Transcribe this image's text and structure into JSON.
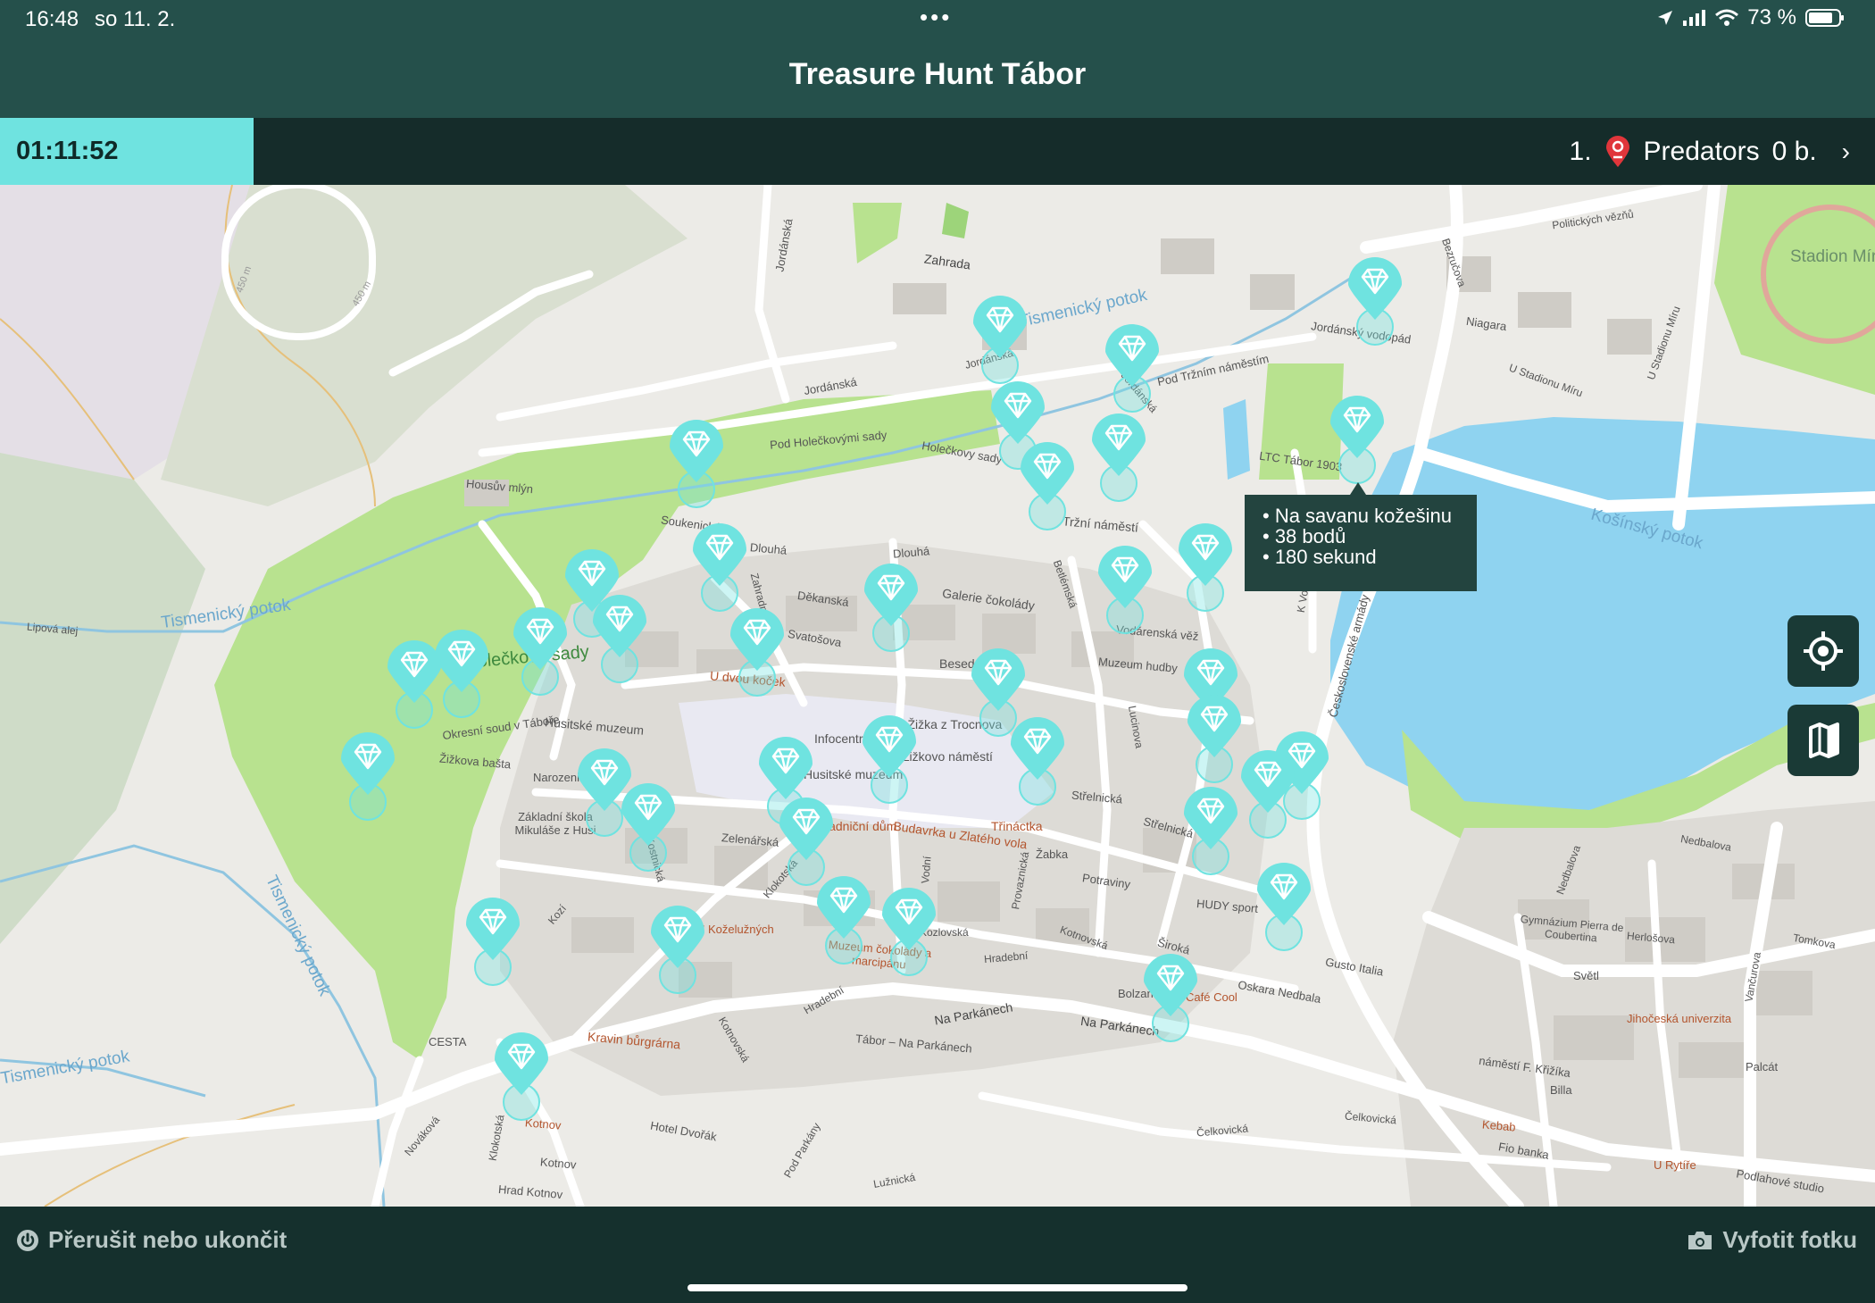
{
  "status_bar": {
    "time": "16:48",
    "date": "so 11. 2.",
    "battery": "73 %"
  },
  "app": {
    "title": "Treasure Hunt Tábor"
  },
  "scoreboard": {
    "timer": "01:11:52",
    "rank": "1.",
    "team": "Predators",
    "points": "0 b."
  },
  "tooltip": {
    "lines": [
      "• Na savanu kožešinu",
      "• 38 bodů",
      "• 180 sekund"
    ]
  },
  "map": {
    "labels": [
      {
        "text": "Jordánská",
        "rot": -80
      },
      {
        "text": "Zahrada",
        "rot": 8
      },
      {
        "text": "Tismenický potok",
        "rot": -12
      },
      {
        "text": "Jordánská",
        "rot": -10
      },
      {
        "text": "Pod Tržním náměstím",
        "rot": -12
      },
      {
        "text": "Jordánský vodopád",
        "rot": 8
      },
      {
        "text": "Politických vězňů",
        "rot": -8
      },
      {
        "text": "Stadion Míru",
        "rot": 0
      },
      {
        "text": "Bezručova",
        "rot": 70
      },
      {
        "text": "Niagara",
        "rot": 8
      },
      {
        "text": "U Stadionu Míru",
        "rot": 20
      },
      {
        "text": "U Stadionu Míru",
        "rot": -70
      },
      {
        "text": "Jordánská",
        "rot": -15
      },
      {
        "text": "Jordánská",
        "rot": 50
      },
      {
        "text": "Pod Holečkovými sady",
        "rot": -5
      },
      {
        "text": "Holečkovy sady",
        "rot": 10
      },
      {
        "text": "LTC Tábor 1903",
        "rot": 8
      },
      {
        "text": "Košínský potok",
        "rot": 15
      },
      {
        "text": "Housův mlýn",
        "rot": 5
      },
      {
        "text": "Soukenická",
        "rot": 8
      },
      {
        "text": "Dlouhá",
        "rot": 5
      },
      {
        "text": "Dlouhá",
        "rot": -5
      },
      {
        "text": "Tržní náměstí",
        "rot": 5
      },
      {
        "text": "Děkanská",
        "rot": 8
      },
      {
        "text": "Galerie čokolády",
        "rot": 8
      },
      {
        "text": "Betlémská",
        "rot": 70
      },
      {
        "text": "Zahradnická",
        "rot": 75
      },
      {
        "text": "Tismenický potok",
        "rot": -8
      },
      {
        "text": "Lipová alej",
        "rot": 5
      },
      {
        "text": "Holečkovy sady",
        "rot": -5
      },
      {
        "text": "Svatošova",
        "rot": 10
      },
      {
        "text": "U dvou koček",
        "rot": 5
      },
      {
        "text": "Beseda",
        "rot": 0
      },
      {
        "text": "Vodárenská věž",
        "rot": 5
      },
      {
        "text": "Muzeum hudby",
        "rot": 5
      },
      {
        "text": "K Vodojemu",
        "rot": -80
      },
      {
        "text": "Československé armády",
        "rot": -75
      },
      {
        "text": "Husitské muzeum",
        "rot": 5
      },
      {
        "text": "Okresní soud v Táboře",
        "rot": -8
      },
      {
        "text": "Žižkova bašta",
        "rot": 5
      },
      {
        "text": "Jan Žižka z Trocnova",
        "rot": 0
      },
      {
        "text": "Žižkovo náměstí",
        "rot": 0
      },
      {
        "text": "Infocentrum",
        "rot": 0
      },
      {
        "text": "Husitské muzeum",
        "rot": 0
      },
      {
        "text": "Lucinova",
        "rot": 80
      },
      {
        "text": "Střelnická",
        "rot": 5
      },
      {
        "text": "Střelnická",
        "rot": 15
      },
      {
        "text": "Narozeniny",
        "rot": 0
      },
      {
        "text": "Základní škola Mikuláše z Husi",
        "rot": 0
      },
      {
        "text": "Zelenářská",
        "rot": 5
      },
      {
        "text": "Kostnická",
        "rot": 75
      },
      {
        "text": "Kozí",
        "rot": -50
      },
      {
        "text": "Klokotská",
        "rot": -50
      },
      {
        "text": "Radniční dům",
        "rot": 0
      },
      {
        "text": "Budavrka u Zlatého vola",
        "rot": 8
      },
      {
        "text": "Vodní",
        "rot": -85
      },
      {
        "text": "Třináctka",
        "rot": 0
      },
      {
        "text": "Žabka",
        "rot": 0
      },
      {
        "text": "Potraviny",
        "rot": 8
      },
      {
        "text": "Provaznická",
        "rot": -80
      },
      {
        "text": "Nedbalova",
        "rot": -70
      },
      {
        "text": "Nedbalova",
        "rot": 10
      },
      {
        "text": "Gymnázium Pierra de Coubertina",
        "rot": 5
      },
      {
        "text": "Herlošova",
        "rot": 5
      },
      {
        "text": "Tomkova",
        "rot": 10
      },
      {
        "text": "Vančurova",
        "rot": -80
      },
      {
        "text": "HUDY sport",
        "rot": 5
      },
      {
        "text": "Gusto Italia",
        "rot": 10
      },
      {
        "text": "U Koželužných",
        "rot": 0
      },
      {
        "text": "Muzeum čokolády a marcipánu",
        "rot": 5
      },
      {
        "text": "Kozlovská",
        "rot": 0
      },
      {
        "text": "Hradební",
        "rot": -5
      },
      {
        "text": "Kotnovská",
        "rot": 20
      },
      {
        "text": "Široká",
        "rot": 15
      },
      {
        "text": "Bolzano",
        "rot": 0
      },
      {
        "text": "Café Cool",
        "rot": 0
      },
      {
        "text": "Oskara Nedbala",
        "rot": 10
      },
      {
        "text": "Světl",
        "rot": 0
      },
      {
        "text": "Jihočeská univerzita",
        "rot": 0
      },
      {
        "text": "Palcát",
        "rot": 0
      },
      {
        "text": "Na Parkánech",
        "rot": -10
      },
      {
        "text": "Na Parkánech",
        "rot": 8
      },
      {
        "text": "Tábor – Na Parkánech",
        "rot": 5
      },
      {
        "text": "Hradební",
        "rot": -30
      },
      {
        "text": "Kotnovská",
        "rot": 60
      },
      {
        "text": "Kravin bůrgrárna",
        "rot": 5
      },
      {
        "text": "CESTA",
        "rot": 0
      },
      {
        "text": "Tismenický potok",
        "rot": -10
      },
      {
        "text": "Tismenický potok",
        "rot": 65
      },
      {
        "text": "Klokotská",
        "rot": -80
      },
      {
        "text": "Kotnov",
        "rot": 5
      },
      {
        "text": "Kotnov",
        "rot": 5
      },
      {
        "text": "Hrad Kotnov",
        "rot": 5
      },
      {
        "text": "Hotel Dvořák",
        "rot": 10
      },
      {
        "text": "Pod Parkány",
        "rot": -60
      },
      {
        "text": "Čelkovická",
        "rot": -5
      },
      {
        "text": "Čelkovická",
        "rot": 5
      },
      {
        "text": "Lužnická",
        "rot": -10
      },
      {
        "text": "Nováková",
        "rot": -50
      },
      {
        "text": "náměstí F. Křižíka",
        "rot": 8
      },
      {
        "text": "Billa",
        "rot": 0
      },
      {
        "text": "Kebab",
        "rot": 5
      },
      {
        "text": "Fio banka",
        "rot": 10
      },
      {
        "text": "U Rytíře",
        "rot": 0
      },
      {
        "text": "Podlahové studio",
        "rot": 10
      },
      {
        "text": "450 m",
        "rot": -70
      },
      {
        "text": "450 m",
        "rot": -60
      }
    ],
    "marker_count": 38
  },
  "bottom": {
    "left_button": "Přerušit nebo ukončit",
    "right_button": "Vyfotit fotku"
  },
  "colors": {
    "accent": "#6fe3e0",
    "header": "#25504b",
    "bar": "#152c2a",
    "water": "#8fd3f0",
    "park": "#b8e28f"
  }
}
